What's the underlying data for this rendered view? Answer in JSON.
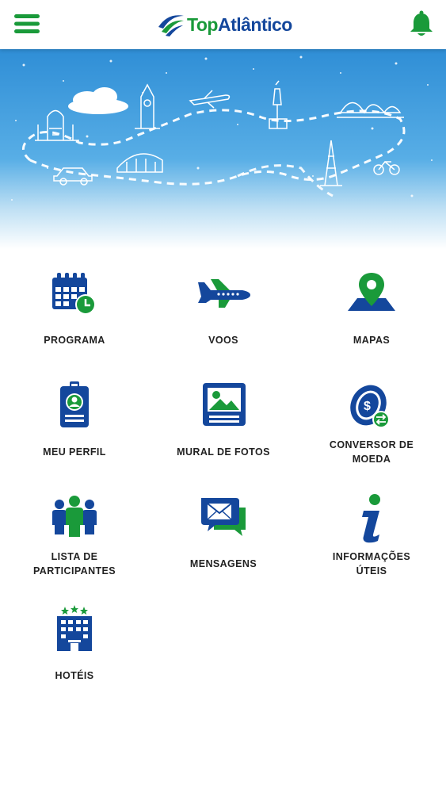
{
  "header": {
    "brand_top": "Top",
    "brand_name": "Atlântico",
    "menu_icon": "hamburger-menu-icon",
    "notification_icon": "bell-icon"
  },
  "colors": {
    "brand_green": "#1a9a3a",
    "brand_blue": "#14479c",
    "sky_top": "#2f8ed6",
    "label_text": "#222222"
  },
  "menu": {
    "items": [
      {
        "line1": "PROGRAMA",
        "line2": "",
        "icon": "calendar-clock-icon"
      },
      {
        "line1": "VOOS",
        "line2": "",
        "icon": "airplane-icon"
      },
      {
        "line1": "MAPAS",
        "line2": "",
        "icon": "map-pin-icon"
      },
      {
        "line1": "MEU PERFIL",
        "line2": "",
        "icon": "id-badge-icon"
      },
      {
        "line1": "MURAL DE FOTOS",
        "line2": "",
        "icon": "photo-frame-icon"
      },
      {
        "line1": "CONVERSOR DE",
        "line2": "MOEDA",
        "icon": "currency-exchange-icon"
      },
      {
        "line1": "LISTA DE",
        "line2": "PARTICIPANTES",
        "icon": "people-group-icon"
      },
      {
        "line1": "MENSAGENS",
        "line2": "",
        "icon": "chat-envelope-icon"
      },
      {
        "line1": "INFORMAÇÕES",
        "line2": "ÚTEIS",
        "icon": "info-icon"
      },
      {
        "line1": "HOTÉIS",
        "line2": "",
        "icon": "hotel-building-icon"
      }
    ]
  }
}
